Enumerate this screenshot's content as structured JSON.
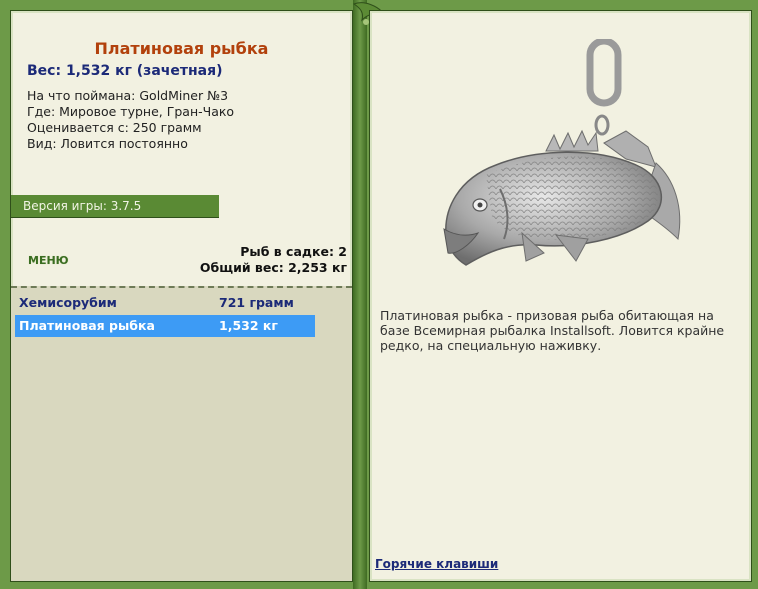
{
  "fish": {
    "title": "Платиновая рыбка",
    "weight_line": "Вес: 1,532 кг (зачетная)",
    "caught_on": "На что поймана: GoldMiner №3",
    "where": "Где: Мировое турне, Гран-Чако",
    "rated_from": "Оценивается с: 250 грамм",
    "kind": "Вид: Ловится постоянно"
  },
  "version_label": "Версия игры: 3.7.5",
  "menu_label": "МЕНЮ",
  "stats": {
    "fish_in_keepnet": "Рыб в садке: 2",
    "total_weight": "Общий вес: 2,253 кг"
  },
  "catch_list": [
    {
      "name": "Хемисорубим",
      "weight": "721 грамм",
      "selected": false
    },
    {
      "name": "Платиновая рыбка",
      "weight": "1,532 кг",
      "selected": true
    }
  ],
  "description": "Платиновая рыбка - призовая рыба обитающая на базе Всемирная рыбалка Installsoft. Ловится крайне редко, на специальную наживку.",
  "hotkeys_label": "Горячие клавиши",
  "colors": {
    "title": "#b2410c",
    "selected_row": "#3d9bf5",
    "frame": "#3f6b22",
    "panel": "#f2f1e1"
  },
  "icons": [
    "fish-pendant-image",
    "leaf-ornament-icon"
  ]
}
